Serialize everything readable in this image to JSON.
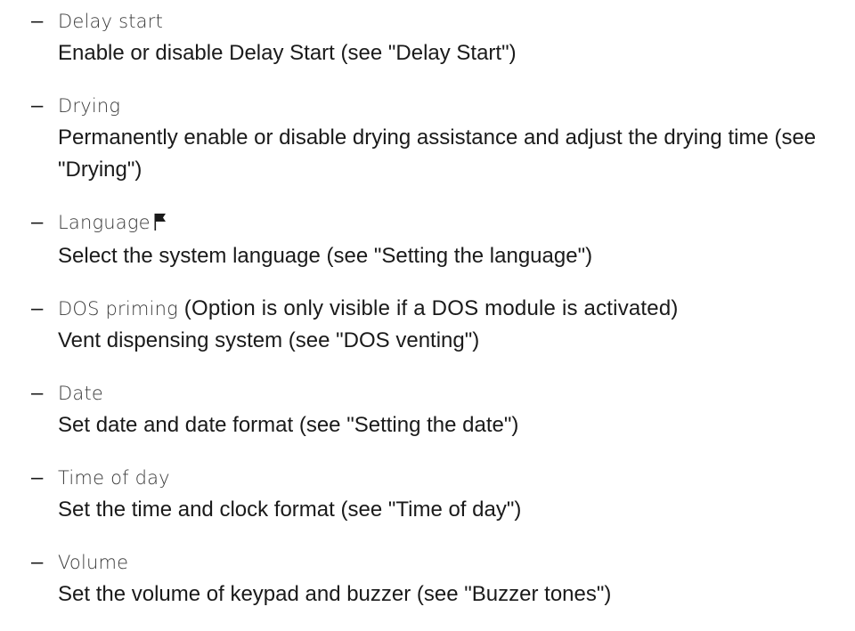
{
  "items": [
    {
      "term": "Delay start",
      "description": "Enable or disable Delay Start (see \"Delay Start\")"
    },
    {
      "term": "Drying",
      "description": "Permanently enable or disable drying assistance and adjust the drying time (see \"Drying\")"
    },
    {
      "term": "Language",
      "icon": "flag-icon",
      "description": "Select the system language (see \"Setting the language\")"
    },
    {
      "term": "DOS priming",
      "note": " (Option is only visible if a DOS module is activated)",
      "description": "Vent dispensing system (see \"DOS venting\")"
    },
    {
      "term": "Date",
      "description": "Set date and date format (see \"Setting the date\")"
    },
    {
      "term": "Time of day",
      "description": "Set the time and clock format (see \"Time of day\")"
    },
    {
      "term": "Volume",
      "description": "Set the volume of keypad and buzzer (see \"Buzzer tones\")"
    }
  ],
  "dash": "–"
}
